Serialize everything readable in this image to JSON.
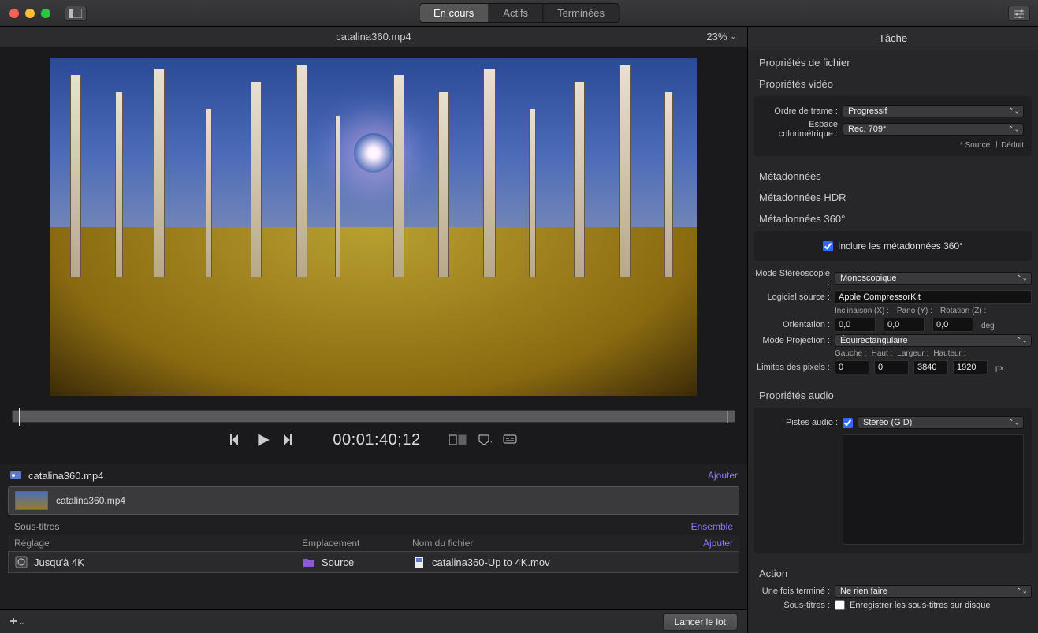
{
  "titlebar": {
    "tabs": {
      "current": "En cours",
      "active": "Actifs",
      "done": "Terminées"
    }
  },
  "filebar": {
    "filename": "catalina360.mp4",
    "zoom": "23%"
  },
  "playback": {
    "timecode": "00:01:40;12"
  },
  "batch": {
    "header_file": "catalina360.mp4",
    "add": "Ajouter",
    "file_row": "catalina360.mp4",
    "subtitles_label": "Sous-titres",
    "ensemble": "Ensemble",
    "cols": {
      "setting": "Réglage",
      "location": "Emplacement",
      "filename": "Nom du fichier"
    },
    "row_add": "Ajouter",
    "setting_value": "Jusqu'à 4K",
    "location_value": "Source",
    "output_value": "catalina360-Up to 4K.mov"
  },
  "bottom": {
    "launch": "Lancer le lot"
  },
  "inspector": {
    "title": "Tâche",
    "file_props": "Propriétés de fichier",
    "video_props": "Propriétés vidéo",
    "field_order_label": "Ordre de trame :",
    "field_order_value": "Progressif",
    "colorspace_label": "Espace colorimétrique :",
    "colorspace_value": "Rec. 709*",
    "colorspace_note": "* Source, † Déduit",
    "metadata": "Métadonnées",
    "hdr": "Métadonnées HDR",
    "m360": "Métadonnées 360°",
    "include_360": "Inclure les métadonnées 360°",
    "stereo_label": "Mode Stéréoscopie :",
    "stereo_value": "Monoscopique",
    "software_label": "Logiciel source :",
    "software_value": "Apple CompressorKit",
    "tilt": "Inclinaison (X) :",
    "pan": "Pano (Y) :",
    "rot": "Rotation (Z) :",
    "orientation_label": "Orientation :",
    "tilt_v": "0,0",
    "pan_v": "0,0",
    "rot_v": "0,0",
    "deg": "deg",
    "projection_label": "Mode Projection :",
    "projection_value": "Équirectangulaire",
    "left": "Gauche :",
    "top": "Haut :",
    "width": "Largeur :",
    "height": "Hauteur :",
    "pixel_limits_label": "Limites des pixels :",
    "left_v": "0",
    "top_v": "0",
    "width_v": "3840",
    "height_v": "1920",
    "px": "px",
    "audio_props": "Propriétés audio",
    "audio_tracks_label": "Pistes audio :",
    "audio_value": "Stéréo (G D)",
    "action": "Action",
    "when_done_label": "Une fois terminé :",
    "when_done_value": "Ne rien faire",
    "subs_label": "Sous-titres :",
    "subs_check": "Enregistrer les sous-titres sur disque"
  }
}
